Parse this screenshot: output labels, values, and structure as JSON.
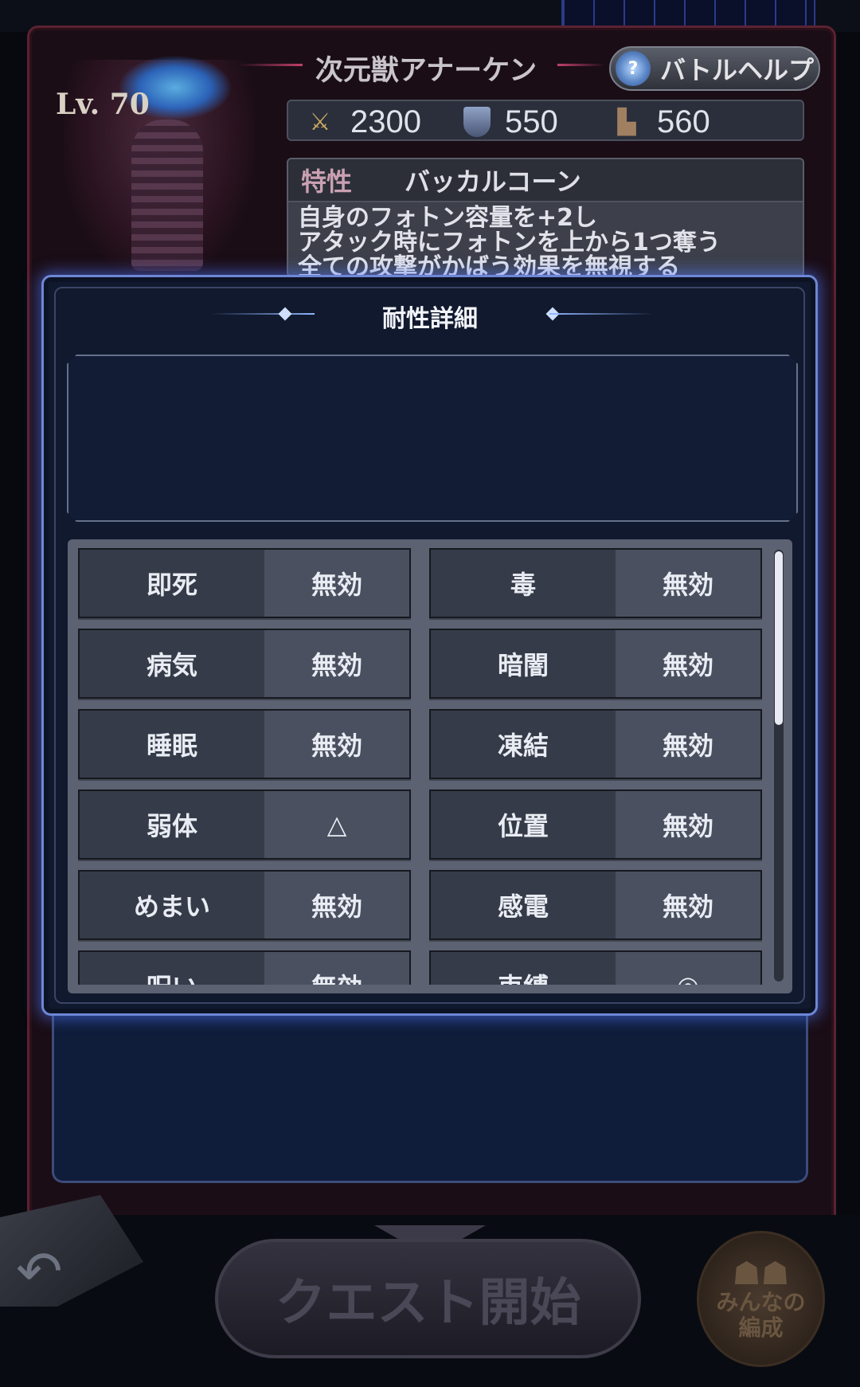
{
  "enemy": {
    "level": "Lv. 70",
    "name": "次元獣アナーケン",
    "stats": {
      "attack": "2300",
      "defense": "550",
      "speed": "560"
    },
    "trait": {
      "label": "特性",
      "name": "バッカルコーン",
      "description_lines": [
        "自身のフォトン容量を+2し",
        "アタック時にフォトンを上から1つ奪う",
        "全ての攻撃がかばう効果を無視する"
      ]
    }
  },
  "header": {
    "help_button": "バトルヘルプ"
  },
  "modal": {
    "title": "耐性詳細",
    "resistances": [
      [
        {
          "name": "即死",
          "value": "無効"
        },
        {
          "name": "毒",
          "value": "無効"
        }
      ],
      [
        {
          "name": "病気",
          "value": "無効"
        },
        {
          "name": "暗闇",
          "value": "無効"
        }
      ],
      [
        {
          "name": "睡眠",
          "value": "無効"
        },
        {
          "name": "凍結",
          "value": "無効"
        }
      ],
      [
        {
          "name": "弱体",
          "value": "△"
        },
        {
          "name": "位置",
          "value": "無効"
        }
      ],
      [
        {
          "name": "めまい",
          "value": "無効"
        },
        {
          "name": "感電",
          "value": "無効"
        }
      ],
      [
        {
          "name": "呪い",
          "value": "無効"
        },
        {
          "name": "束縛",
          "value": "◎"
        }
      ]
    ],
    "scroll_position": 0
  },
  "footer": {
    "quest_start": "クエスト開始",
    "team_button": [
      "みんなの",
      "編成"
    ]
  },
  "icons": {
    "attack": "sword-icon",
    "defense": "shield-icon",
    "speed": "boot-icon",
    "help": "help-icon",
    "back": "back-arrow-icon",
    "team": "people-icon"
  }
}
